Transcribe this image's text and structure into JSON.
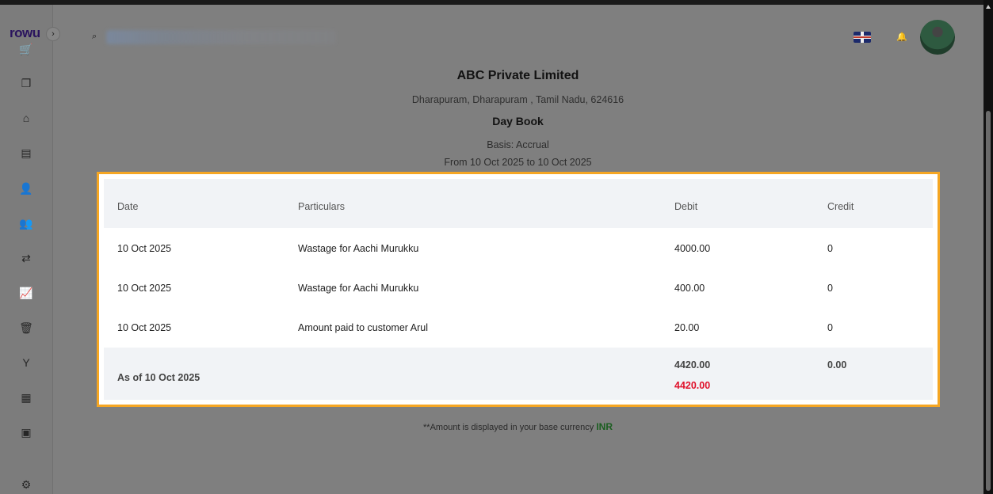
{
  "sidebar": {
    "logo": "rowu",
    "collapse": "›",
    "icons": [
      {
        "name": "cart-icon",
        "glyph": "🛒"
      },
      {
        "name": "copy-icon",
        "glyph": "❐"
      },
      {
        "name": "store-icon",
        "glyph": "⌂"
      },
      {
        "name": "book-icon",
        "glyph": "▤"
      },
      {
        "name": "user-check-icon",
        "glyph": "👤"
      },
      {
        "name": "users-icon",
        "glyph": "👥"
      },
      {
        "name": "transfer-icon",
        "glyph": "⇄"
      },
      {
        "name": "chart-icon",
        "glyph": "📈"
      },
      {
        "name": "trash-icon",
        "glyph": "🗑"
      },
      {
        "name": "tools-icon",
        "glyph": "Y"
      },
      {
        "name": "calculator-icon",
        "glyph": "▦"
      },
      {
        "name": "contact-icon",
        "glyph": "▣"
      },
      {
        "name": "settings-icon",
        "glyph": "⚙"
      }
    ]
  },
  "header": {
    "search_icon": "⌕",
    "bell_icon": "🔔"
  },
  "report": {
    "company": "ABC Private Limited",
    "address": "Dharapuram, Dharapuram , Tamil Nadu, 624616",
    "title": "Day Book",
    "basis": "Basis: Accrual",
    "range": "From 10 Oct 2025 to 10 Oct 2025"
  },
  "table": {
    "headers": {
      "date": "Date",
      "particulars": "Particulars",
      "debit": "Debit",
      "credit": "Credit"
    },
    "rows": [
      {
        "date": "10 Oct 2025",
        "particulars": "Wastage for Aachi Murukku",
        "debit": "4000.00",
        "credit": "0"
      },
      {
        "date": "10 Oct 2025",
        "particulars": "Wastage for Aachi Murukku",
        "debit": "400.00",
        "credit": "0"
      },
      {
        "date": "10 Oct 2025",
        "particulars": "Amount paid to customer Arul",
        "debit": "20.00",
        "credit": "0"
      }
    ],
    "footer": {
      "label": "As of 10 Oct 2025",
      "debit_total": "4420.00",
      "credit_total": "0.00",
      "debit_diff": "4420.00"
    }
  },
  "note": {
    "text": "**Amount is displayed in your base currency",
    "currency": "INR"
  },
  "colors": {
    "highlight": "#f5a623",
    "red": "#e0112b",
    "currency": "#1b5e20"
  }
}
